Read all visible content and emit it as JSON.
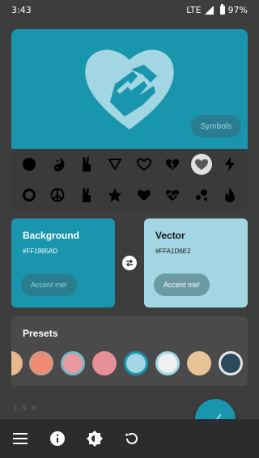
{
  "status": {
    "time": "3:43",
    "network": "LTE",
    "battery": "97%"
  },
  "preview": {
    "background_color": "#1995ad",
    "vector_color": "#a1d6e2",
    "symbols_label": "Symbols"
  },
  "icon_grid": {
    "row1": [
      "circle-filled-icon",
      "yin-yang-icon",
      "peace-hand-icon",
      "triangle-down-outline-icon",
      "heart-outline-icon",
      "heart-broken-icon",
      "handshake-heart-icon",
      "lightning-icon"
    ],
    "row2": [
      "circle-outline-icon",
      "peace-icon",
      "peace-hand-icon",
      "star-icon",
      "heart-filled-icon",
      "heart-pulse-icon",
      "dots-icon",
      "fire-icon"
    ],
    "selected": "handshake-heart-icon"
  },
  "background_card": {
    "title": "Background",
    "hex": "#FF1995AD",
    "accent_label": "Accent me!"
  },
  "vector_card": {
    "title": "Vector",
    "hex": "#FFA1D6E2",
    "accent_label": "Accent me!"
  },
  "presets": {
    "title": "Presets",
    "swatches": [
      "#e8b88a",
      "#f08a70",
      "#e89aa0",
      "#e8909a",
      "#a1d6e2",
      "#f0f0f0",
      "#e6c497",
      "#2a4a5e"
    ]
  },
  "version": "1.9.6",
  "bottom_bar": [
    "menu-icon",
    "info-icon",
    "brightness-icon",
    "reset-icon"
  ]
}
